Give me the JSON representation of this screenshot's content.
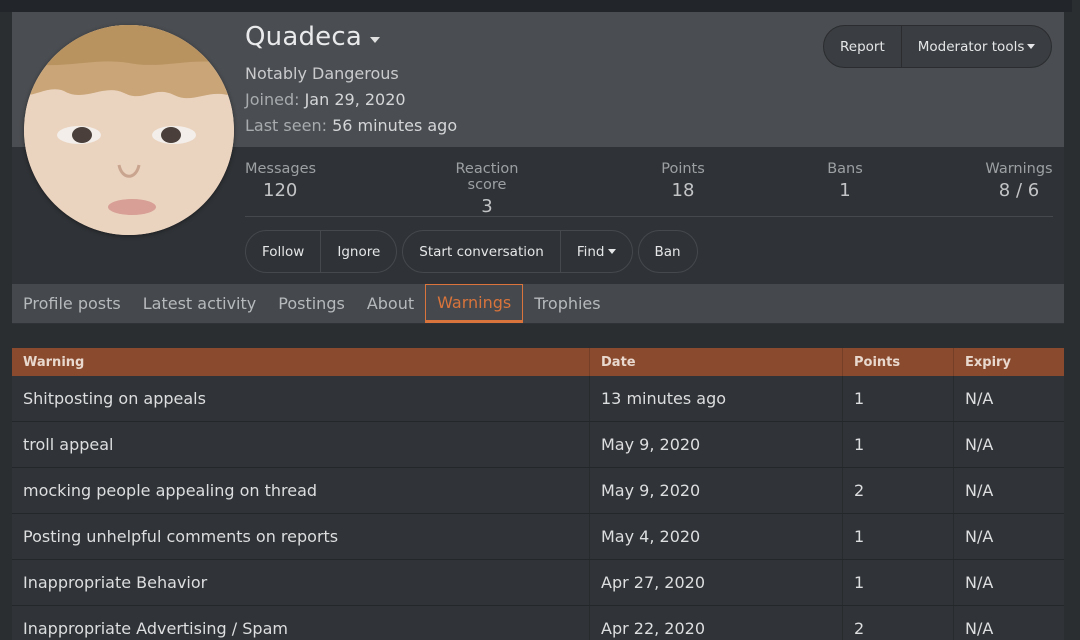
{
  "profile": {
    "username": "Quadeca",
    "title": "Notably Dangerous",
    "joined_label": "Joined:",
    "joined_value": "Jan 29, 2020",
    "last_seen_label": "Last seen:",
    "last_seen_value": "56 minutes ago"
  },
  "top_actions": {
    "report": "Report",
    "moderator_tools": "Moderator tools"
  },
  "stats": [
    {
      "label": "Messages",
      "value": "120"
    },
    {
      "label": "Reaction score",
      "value": "3"
    },
    {
      "label": "Points",
      "value": "18"
    },
    {
      "label": "Bans",
      "value": "1"
    },
    {
      "label": "Warnings",
      "value": "8 / 6"
    }
  ],
  "actions": {
    "follow": "Follow",
    "ignore": "Ignore",
    "start_conversation": "Start conversation",
    "find": "Find",
    "ban": "Ban"
  },
  "tabs": [
    {
      "label": "Profile posts"
    },
    {
      "label": "Latest activity"
    },
    {
      "label": "Postings"
    },
    {
      "label": "About"
    },
    {
      "label": "Warnings",
      "active": true
    },
    {
      "label": "Trophies"
    }
  ],
  "warnings_table": {
    "headers": [
      "Warning",
      "Date",
      "Points",
      "Expiry"
    ],
    "rows": [
      {
        "warning": "Shitposting on appeals",
        "date": "13 minutes ago",
        "points": "1",
        "expiry": "N/A"
      },
      {
        "warning": "troll appeal",
        "date": "May 9, 2020",
        "points": "1",
        "expiry": "N/A"
      },
      {
        "warning": "mocking people appealing on thread",
        "date": "May 9, 2020",
        "points": "2",
        "expiry": "N/A"
      },
      {
        "warning": "Posting unhelpful comments on reports",
        "date": "May 4, 2020",
        "points": "1",
        "expiry": "N/A"
      },
      {
        "warning": "Inappropriate Behavior",
        "date": "Apr 27, 2020",
        "points": "1",
        "expiry": "N/A"
      },
      {
        "warning": "Inappropriate Advertising / Spam",
        "date": "Apr 22, 2020",
        "points": "2",
        "expiry": "N/A"
      }
    ]
  },
  "colors": {
    "accent": "#d8743c",
    "table_header": "#8a4a2e",
    "background": "#2b2e31"
  }
}
